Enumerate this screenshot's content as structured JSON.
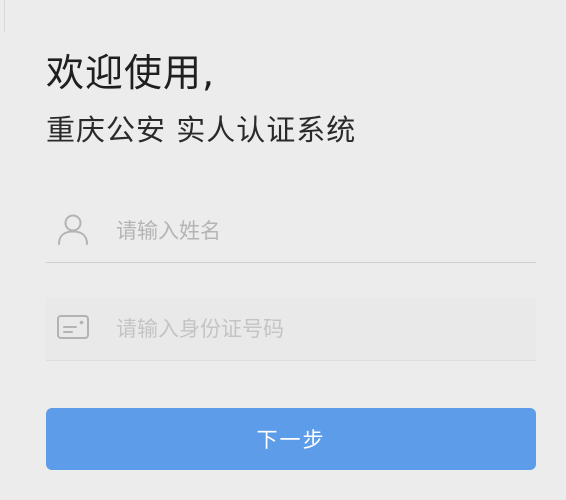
{
  "header": {
    "welcome": "欢迎使用,",
    "subtitle": "重庆公安 实人认证系统"
  },
  "form": {
    "name_field": {
      "placeholder": "请输入姓名",
      "value": "",
      "icon": "user-icon"
    },
    "id_field": {
      "placeholder": "请输入身份证号码",
      "value": "",
      "icon": "id-card-icon"
    },
    "next_button": {
      "label": "下一步"
    }
  },
  "colors": {
    "background": "#ececec",
    "accent": "#5d9ce8",
    "placeholder": "#b5b5b5",
    "divider": "#cfcfcf"
  }
}
